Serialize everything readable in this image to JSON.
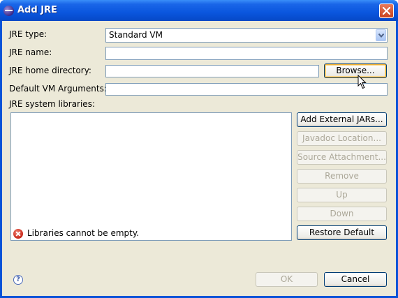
{
  "window": {
    "title": "Add JRE"
  },
  "form": {
    "jre_type_label": "JRE type:",
    "jre_type_value": "Standard VM",
    "jre_name_label": "JRE name:",
    "jre_name_value": "",
    "jre_home_label": "JRE home directory:",
    "jre_home_value": "",
    "browse_label": "Browse...",
    "vm_args_label": "Default VM Arguments:",
    "vm_args_value": "",
    "libraries_label": "JRE system libraries:"
  },
  "library_buttons": {
    "add_external_jars": "Add External JARs...",
    "javadoc_location": "Javadoc Location...",
    "source_attachment": "Source Attachment...",
    "remove": "Remove",
    "up": "Up",
    "down": "Down",
    "restore_default": "Restore Default"
  },
  "status": {
    "error_message": "Libraries cannot be empty."
  },
  "footer": {
    "help_glyph": "?",
    "ok_label": "OK",
    "cancel_label": "Cancel"
  },
  "colors": {
    "title_bar": "#0a56de",
    "dialog_background": "#ece9d8",
    "field_border": "#7f9db9",
    "error_icon": "#c8281a"
  },
  "icons": [
    "eclipse-app-icon",
    "close-icon",
    "chevron-down-icon",
    "error-icon",
    "help-icon",
    "mouse-pointer-icon"
  ]
}
